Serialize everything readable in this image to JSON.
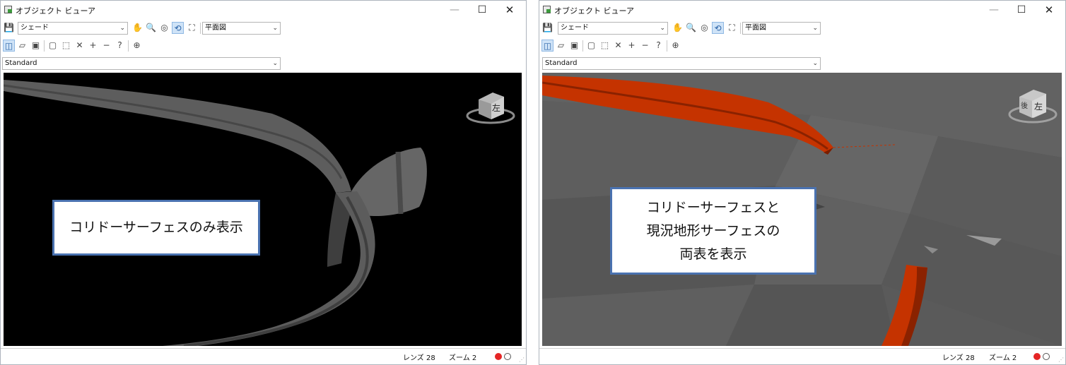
{
  "windows": [
    {
      "title": "オブジェクト ビューア",
      "visual_style": "シェード",
      "view": "平面図",
      "display_style": "Standard",
      "status": {
        "lens": "レンズ 28",
        "zoom": "ズーム 2"
      },
      "viewcube": {
        "face": "左",
        "back": ""
      },
      "callout": [
        "コリドーサーフェスのみ表示"
      ]
    },
    {
      "title": "オブジェクト ビューア",
      "visual_style": "シェード",
      "view": "平面図",
      "display_style": "Standard",
      "status": {
        "lens": "レンズ 28",
        "zoom": "ズーム 2"
      },
      "viewcube": {
        "face": "左",
        "back": "後"
      },
      "callout": [
        "コリドーサーフェスと",
        "現況地形サーフェスの",
        "両表を表示"
      ]
    }
  ],
  "icons": [
    "save-icon",
    "pan-icon",
    "zoom-icon",
    "orbit-icon",
    "3d-orbit-icon",
    "camera-icon",
    "wireframe-icon",
    "shaded-icon",
    "snapshot-icon",
    "zoom-window-icon",
    "zoom-extents-icon",
    "zoom-fit-icon",
    "zoom-in-icon",
    "zoom-out-icon",
    "zoom-query-icon",
    "target-icon"
  ],
  "colors": {
    "corridor": "#c53300",
    "terrain": "#5a5a5a",
    "callout_border": "#4a72b0",
    "active_tool": "#cfe3f7"
  }
}
